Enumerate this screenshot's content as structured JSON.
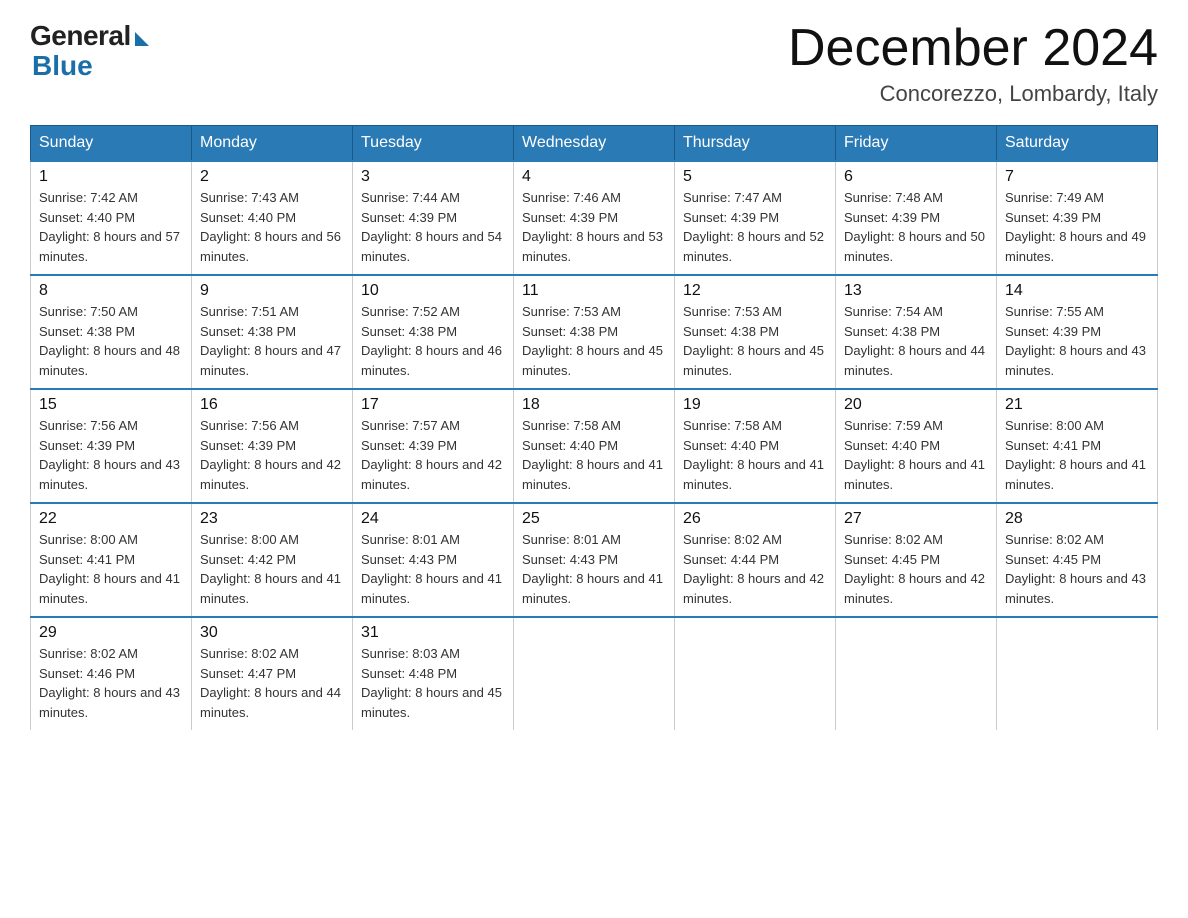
{
  "logo": {
    "general": "General",
    "blue": "Blue"
  },
  "title": "December 2024",
  "location": "Concorezzo, Lombardy, Italy",
  "days_of_week": [
    "Sunday",
    "Monday",
    "Tuesday",
    "Wednesday",
    "Thursday",
    "Friday",
    "Saturday"
  ],
  "weeks": [
    [
      {
        "day": 1,
        "sunrise": "7:42 AM",
        "sunset": "4:40 PM",
        "daylight": "8 hours and 57 minutes."
      },
      {
        "day": 2,
        "sunrise": "7:43 AM",
        "sunset": "4:40 PM",
        "daylight": "8 hours and 56 minutes."
      },
      {
        "day": 3,
        "sunrise": "7:44 AM",
        "sunset": "4:39 PM",
        "daylight": "8 hours and 54 minutes."
      },
      {
        "day": 4,
        "sunrise": "7:46 AM",
        "sunset": "4:39 PM",
        "daylight": "8 hours and 53 minutes."
      },
      {
        "day": 5,
        "sunrise": "7:47 AM",
        "sunset": "4:39 PM",
        "daylight": "8 hours and 52 minutes."
      },
      {
        "day": 6,
        "sunrise": "7:48 AM",
        "sunset": "4:39 PM",
        "daylight": "8 hours and 50 minutes."
      },
      {
        "day": 7,
        "sunrise": "7:49 AM",
        "sunset": "4:39 PM",
        "daylight": "8 hours and 49 minutes."
      }
    ],
    [
      {
        "day": 8,
        "sunrise": "7:50 AM",
        "sunset": "4:38 PM",
        "daylight": "8 hours and 48 minutes."
      },
      {
        "day": 9,
        "sunrise": "7:51 AM",
        "sunset": "4:38 PM",
        "daylight": "8 hours and 47 minutes."
      },
      {
        "day": 10,
        "sunrise": "7:52 AM",
        "sunset": "4:38 PM",
        "daylight": "8 hours and 46 minutes."
      },
      {
        "day": 11,
        "sunrise": "7:53 AM",
        "sunset": "4:38 PM",
        "daylight": "8 hours and 45 minutes."
      },
      {
        "day": 12,
        "sunrise": "7:53 AM",
        "sunset": "4:38 PM",
        "daylight": "8 hours and 45 minutes."
      },
      {
        "day": 13,
        "sunrise": "7:54 AM",
        "sunset": "4:38 PM",
        "daylight": "8 hours and 44 minutes."
      },
      {
        "day": 14,
        "sunrise": "7:55 AM",
        "sunset": "4:39 PM",
        "daylight": "8 hours and 43 minutes."
      }
    ],
    [
      {
        "day": 15,
        "sunrise": "7:56 AM",
        "sunset": "4:39 PM",
        "daylight": "8 hours and 43 minutes."
      },
      {
        "day": 16,
        "sunrise": "7:56 AM",
        "sunset": "4:39 PM",
        "daylight": "8 hours and 42 minutes."
      },
      {
        "day": 17,
        "sunrise": "7:57 AM",
        "sunset": "4:39 PM",
        "daylight": "8 hours and 42 minutes."
      },
      {
        "day": 18,
        "sunrise": "7:58 AM",
        "sunset": "4:40 PM",
        "daylight": "8 hours and 41 minutes."
      },
      {
        "day": 19,
        "sunrise": "7:58 AM",
        "sunset": "4:40 PM",
        "daylight": "8 hours and 41 minutes."
      },
      {
        "day": 20,
        "sunrise": "7:59 AM",
        "sunset": "4:40 PM",
        "daylight": "8 hours and 41 minutes."
      },
      {
        "day": 21,
        "sunrise": "8:00 AM",
        "sunset": "4:41 PM",
        "daylight": "8 hours and 41 minutes."
      }
    ],
    [
      {
        "day": 22,
        "sunrise": "8:00 AM",
        "sunset": "4:41 PM",
        "daylight": "8 hours and 41 minutes."
      },
      {
        "day": 23,
        "sunrise": "8:00 AM",
        "sunset": "4:42 PM",
        "daylight": "8 hours and 41 minutes."
      },
      {
        "day": 24,
        "sunrise": "8:01 AM",
        "sunset": "4:43 PM",
        "daylight": "8 hours and 41 minutes."
      },
      {
        "day": 25,
        "sunrise": "8:01 AM",
        "sunset": "4:43 PM",
        "daylight": "8 hours and 41 minutes."
      },
      {
        "day": 26,
        "sunrise": "8:02 AM",
        "sunset": "4:44 PM",
        "daylight": "8 hours and 42 minutes."
      },
      {
        "day": 27,
        "sunrise": "8:02 AM",
        "sunset": "4:45 PM",
        "daylight": "8 hours and 42 minutes."
      },
      {
        "day": 28,
        "sunrise": "8:02 AM",
        "sunset": "4:45 PM",
        "daylight": "8 hours and 43 minutes."
      }
    ],
    [
      {
        "day": 29,
        "sunrise": "8:02 AM",
        "sunset": "4:46 PM",
        "daylight": "8 hours and 43 minutes."
      },
      {
        "day": 30,
        "sunrise": "8:02 AM",
        "sunset": "4:47 PM",
        "daylight": "8 hours and 44 minutes."
      },
      {
        "day": 31,
        "sunrise": "8:03 AM",
        "sunset": "4:48 PM",
        "daylight": "8 hours and 45 minutes."
      },
      null,
      null,
      null,
      null
    ]
  ]
}
